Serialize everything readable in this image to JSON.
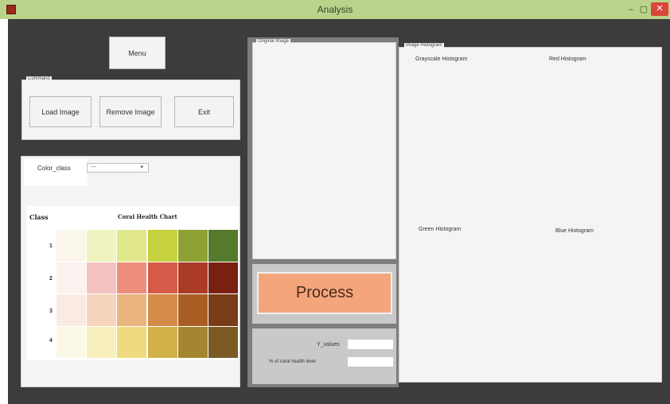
{
  "window": {
    "title": "Analysis",
    "minimize": "–",
    "maximize": "▢",
    "close": "✕"
  },
  "menu": {
    "label": "Menu"
  },
  "command": {
    "group_label": "Command",
    "load_label": "Load Image",
    "remove_label": "Remove Image",
    "exit_label": "Exit"
  },
  "color_class": {
    "label": "Color_class",
    "selected": "---"
  },
  "chart": {
    "class_label": "Class",
    "title": "Coral Health Chart",
    "rows": [
      "1",
      "2",
      "3",
      "4"
    ],
    "colors": [
      [
        "#fbf6ea",
        "#eff3c0",
        "#e1e88c",
        "#c6d33e",
        "#8ea134",
        "#567a2c"
      ],
      [
        "#fbf1ee",
        "#f5c3bf",
        "#ee8e7c",
        "#d65a48",
        "#ab3a26",
        "#7b1f13"
      ],
      [
        "#faebe2",
        "#f6d5bd",
        "#eab47f",
        "#d58b4a",
        "#a85e23",
        "#7a3c18"
      ],
      [
        "#fbf9e6",
        "#f7efbc",
        "#f0da7f",
        "#d3b149",
        "#a58630",
        "#7b5a24"
      ]
    ]
  },
  "original_image": {
    "label": "Original Image"
  },
  "histogram": {
    "label": "Image Histogram",
    "grayscale": "Grayscale Histogram",
    "red": "Red Histogram",
    "green": "Green Histogram",
    "blue": "Blue Histogram"
  },
  "process": {
    "label": "Process"
  },
  "results": {
    "y_values_label": "Y_values",
    "y_values_value": "",
    "health_label": "% of coral health level",
    "health_value": ""
  }
}
